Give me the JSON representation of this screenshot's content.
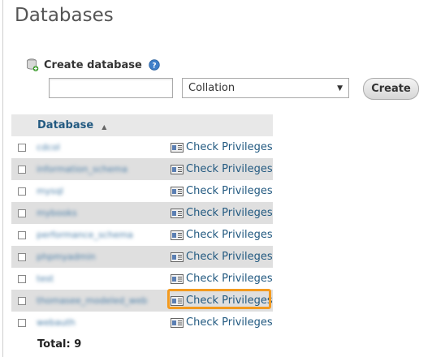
{
  "page": {
    "title": "Databases"
  },
  "create": {
    "label": "Create database",
    "name_value": "",
    "collation_value": "Collation",
    "button_label": "Create"
  },
  "table": {
    "header": "Database",
    "rows": [
      {
        "name": "cdcol",
        "action": "Check Privileges"
      },
      {
        "name": "information_schema",
        "action": "Check Privileges"
      },
      {
        "name": "mysql",
        "action": "Check Privileges"
      },
      {
        "name": "mybooks",
        "action": "Check Privileges"
      },
      {
        "name": "performance_schema",
        "action": "Check Privileges"
      },
      {
        "name": "phpmyadmin",
        "action": "Check Privileges"
      },
      {
        "name": "test",
        "action": "Check Privileges"
      },
      {
        "name": "thomasee_modeled_web",
        "action": "Check Privileges"
      },
      {
        "name": "webauth",
        "action": "Check Privileges"
      }
    ],
    "total": "Total: 9"
  },
  "colors": {
    "link": "#235a81",
    "highlight": "#f39a1f",
    "row_alt": "#dfdfdf"
  }
}
